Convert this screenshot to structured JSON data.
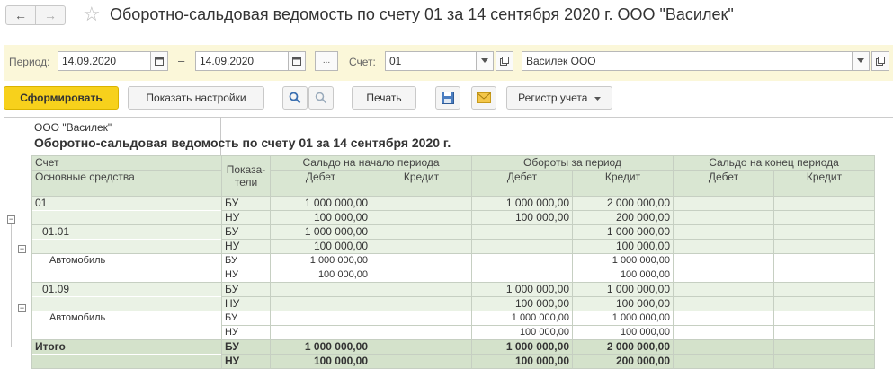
{
  "window": {
    "title": "Оборотно-сальдовая ведомость по счету 01 за 14 сентября 2020 г. ООО \"Василек\"",
    "back_glyph": "←",
    "forward_glyph": "→",
    "star_glyph": "☆"
  },
  "filters": {
    "period_label": "Период:",
    "date_from": "14.09.2020",
    "date_to": "14.09.2020",
    "dash": "–",
    "more_button": "...",
    "account_label": "Счет:",
    "account_value": "01",
    "organization_value": "Василек ООО"
  },
  "toolbar": {
    "generate": "Сформировать",
    "show_settings": "Показать настройки",
    "print": "Печать",
    "register": "Регистр учета"
  },
  "report": {
    "organization": "ООО \"Василек\"",
    "title": "Оборотно-сальдовая ведомость по счету 01 за 14 сентября 2020 г.",
    "headers": {
      "account": "Счет",
      "account_sub": "Основные средства",
      "indicators_1": "Показа-",
      "indicators_2": "тели",
      "opening": "Сальдо на начало периода",
      "turnover": "Обороты за период",
      "closing": "Сальдо на конец периода",
      "debit": "Дебет",
      "credit": "Кредит"
    },
    "rows": [
      {
        "name": "01",
        "ind": "БУ",
        "od": "1 000 000,00",
        "oc": "",
        "td": "1 000 000,00",
        "tc": "2 000 000,00",
        "cd": "",
        "cc": ""
      },
      {
        "name": "",
        "ind": "НУ",
        "od": "100 000,00",
        "oc": "",
        "td": "100 000,00",
        "tc": "200 000,00",
        "cd": "",
        "cc": ""
      },
      {
        "name": "01.01",
        "ind": "БУ",
        "od": "1 000 000,00",
        "oc": "",
        "td": "",
        "tc": "1 000 000,00",
        "cd": "",
        "cc": ""
      },
      {
        "name": "",
        "ind": "НУ",
        "od": "100 000,00",
        "oc": "",
        "td": "",
        "tc": "100 000,00",
        "cd": "",
        "cc": ""
      },
      {
        "name": "Автомобиль",
        "ind": "БУ",
        "od": "1 000 000,00",
        "oc": "",
        "td": "",
        "tc": "1 000 000,00",
        "cd": "",
        "cc": ""
      },
      {
        "name": "",
        "ind": "НУ",
        "od": "100 000,00",
        "oc": "",
        "td": "",
        "tc": "100 000,00",
        "cd": "",
        "cc": ""
      },
      {
        "name": "01.09",
        "ind": "БУ",
        "od": "",
        "oc": "",
        "td": "1 000 000,00",
        "tc": "1 000 000,00",
        "cd": "",
        "cc": ""
      },
      {
        "name": "",
        "ind": "НУ",
        "od": "",
        "oc": "",
        "td": "100 000,00",
        "tc": "100 000,00",
        "cd": "",
        "cc": ""
      },
      {
        "name": "Автомобиль",
        "ind": "БУ",
        "od": "",
        "oc": "",
        "td": "1 000 000,00",
        "tc": "1 000 000,00",
        "cd": "",
        "cc": ""
      },
      {
        "name": "",
        "ind": "НУ",
        "od": "",
        "oc": "",
        "td": "100 000,00",
        "tc": "100 000,00",
        "cd": "",
        "cc": ""
      },
      {
        "name": "Итого",
        "ind": "БУ",
        "od": "1 000 000,00",
        "oc": "",
        "td": "1 000 000,00",
        "tc": "2 000 000,00",
        "cd": "",
        "cc": ""
      },
      {
        "name": "",
        "ind": "НУ",
        "od": "100 000,00",
        "oc": "",
        "td": "100 000,00",
        "tc": "200 000,00",
        "cd": "",
        "cc": ""
      }
    ]
  },
  "colors": {
    "primary_button": "#f7d11c",
    "filter_panel": "#fbf7d9",
    "header_bg": "#d9e6d2",
    "group_row_bg": "#eaf2e5",
    "total_row_bg": "#d4e2cb"
  }
}
